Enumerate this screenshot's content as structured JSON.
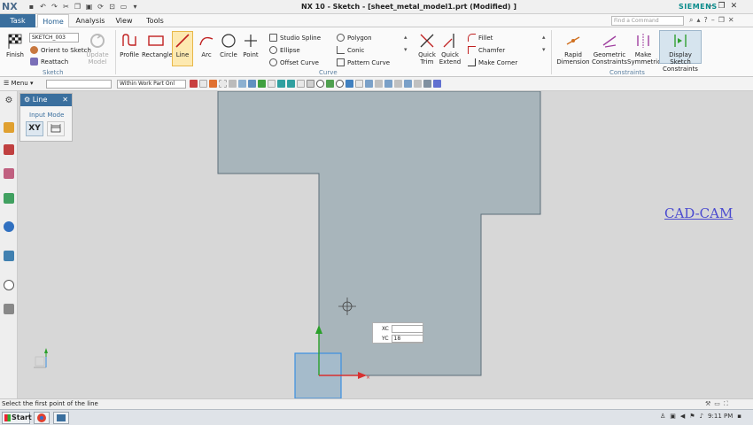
{
  "app": {
    "logo": "NX",
    "window_title": "NX 10 - Sketch - [sheet_metal_model1.prt (Modified) ]",
    "brand": "SIEMENS"
  },
  "tabs": {
    "task": "Task",
    "items": [
      "Home",
      "Analysis",
      "View",
      "Tools"
    ],
    "active": "Home",
    "find_placeholder": "Find a Command"
  },
  "ribbon": {
    "sketch_group": {
      "finish": "Finish",
      "sketch_name": "SKETCH_003",
      "orient": "Orient to Sketch",
      "reattach": "Reattach",
      "update_model": "Update Model",
      "label": "Sketch"
    },
    "curve_group": {
      "profile": "Profile",
      "rectangle": "Rectangle",
      "line": "Line",
      "arc": "Arc",
      "circle": "Circle",
      "point": "Point",
      "studio_spline": "Studio Spline",
      "ellipse": "Ellipse",
      "offset_curve": "Offset Curve",
      "polygon": "Polygon",
      "conic": "Conic",
      "pattern_curve": "Pattern Curve",
      "quick_trim": "Quick Trim",
      "quick_extend": "Quick Extend",
      "fillet": "Fillet",
      "chamfer": "Chamfer",
      "make_corner": "Make Corner",
      "label": "Curve"
    },
    "constraints_group": {
      "rapid_dimension": "Rapid Dimension",
      "geometric_constraints": "Geometric Constraints",
      "make_symmetric": "Make Symmetric",
      "display_sketch_constraints": "Display Sketch Constraints",
      "label": "Constraints"
    }
  },
  "toolbar2": {
    "menu": "Menu",
    "filter_value": "",
    "scope_value": "Within Work Part Onl"
  },
  "line_dialog": {
    "title": "Line",
    "input_mode_label": "Input Mode",
    "xy_label": "XY"
  },
  "coord_input": {
    "xc_label": "XC",
    "xc_value": "",
    "yc_label": "YC",
    "yc_value": "18"
  },
  "watermark": "CAD-CAM",
  "status": {
    "message": "Select the first point of the line"
  },
  "taskbar": {
    "start": "Start",
    "clock": "9:11 PM"
  },
  "colors": {
    "accent": "#3a6f9e",
    "sheet_fill": "#a8b5bb",
    "sheet_stroke": "#5c6e78",
    "axis_x": "#d83030",
    "axis_y": "#2aa02a",
    "axis_box": "#3b8fe0"
  }
}
